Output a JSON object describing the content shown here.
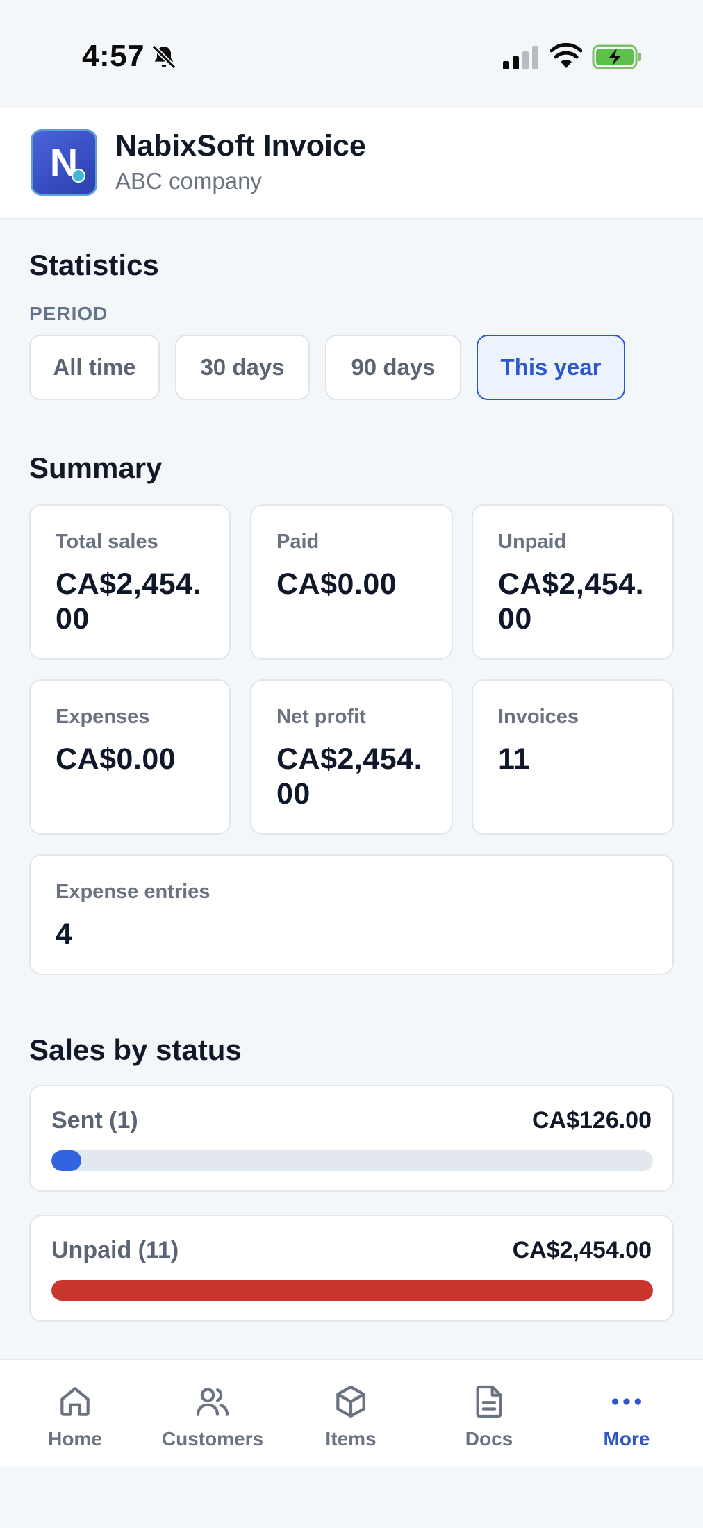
{
  "status_bar": {
    "time": "4:57"
  },
  "header": {
    "title": "NabixSoft Invoice",
    "subtitle": "ABC company",
    "logo_letter": "N"
  },
  "statistics": {
    "title": "Statistics",
    "period_label": "PERIOD",
    "periods": [
      "All time",
      "30 days",
      "90 days",
      "This year"
    ],
    "selected_period": "This year"
  },
  "summary": {
    "title": "Summary",
    "cards": [
      {
        "label": "Total sales",
        "value": "CA$2,454.00"
      },
      {
        "label": "Paid",
        "value": "CA$0.00"
      },
      {
        "label": "Unpaid",
        "value": "CA$2,454.00"
      },
      {
        "label": "Expenses",
        "value": "CA$0.00"
      },
      {
        "label": "Net profit",
        "value": "CA$2,454.00"
      },
      {
        "label": "Invoices",
        "value": "11"
      },
      {
        "label": "Expense entries",
        "value": "4"
      }
    ]
  },
  "sales_by_status": {
    "title": "Sales by status",
    "items": [
      {
        "label": "Sent (1)",
        "amount": "CA$126.00",
        "fraction": 0.05,
        "color": "#3463e0"
      },
      {
        "label": "Unpaid (11)",
        "amount": "CA$2,454.00",
        "fraction": 1.0,
        "color": "#c9372c"
      }
    ]
  },
  "bottom_nav": {
    "items": [
      {
        "label": "Home",
        "icon": "home-icon"
      },
      {
        "label": "Customers",
        "icon": "users-icon"
      },
      {
        "label": "Items",
        "icon": "box-icon"
      },
      {
        "label": "Docs",
        "icon": "document-icon"
      },
      {
        "label": "More",
        "icon": "more-icon"
      }
    ],
    "active": "More"
  },
  "colors": {
    "accent": "#2f56c9",
    "background": "#f4f7fa"
  }
}
